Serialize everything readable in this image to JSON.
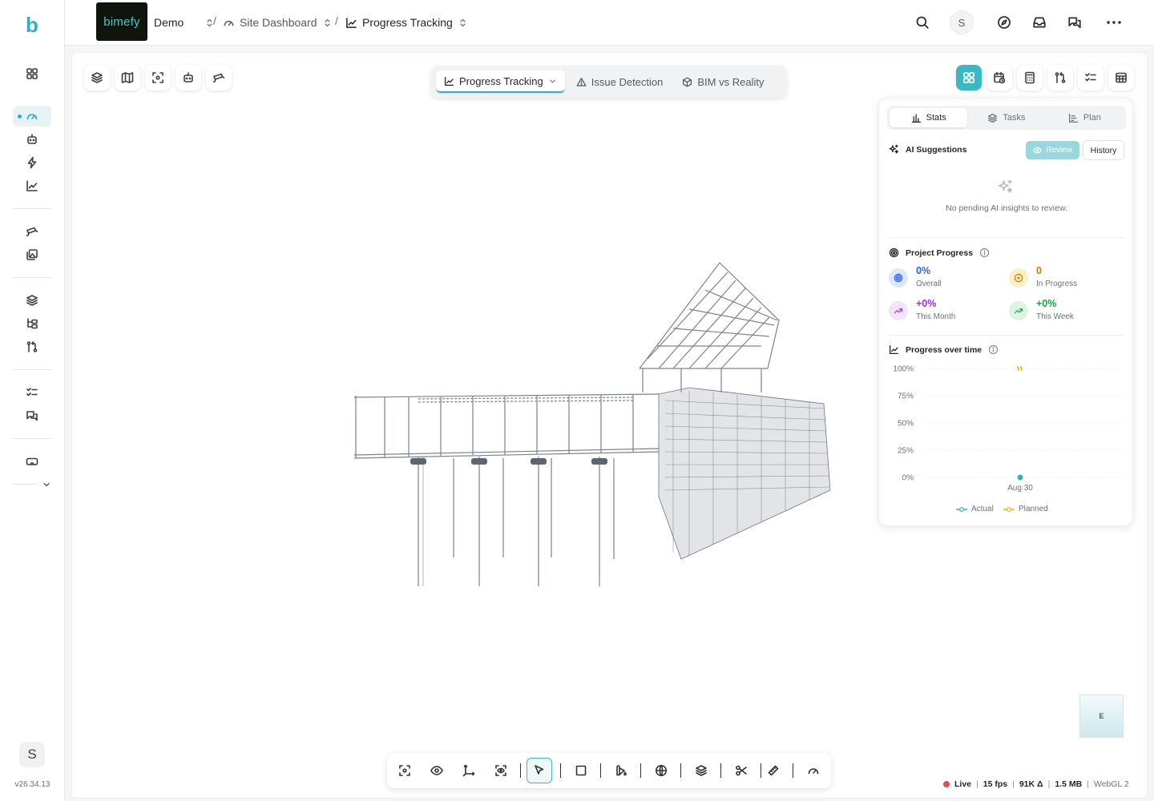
{
  "app": {
    "logo_letter": "b",
    "version": "v26.34.13",
    "user_initial": "S"
  },
  "brand": {
    "name": "bimefy"
  },
  "breadcrumb": {
    "project": "Demo",
    "sep1": "/",
    "section": "Site Dashboard",
    "sep2": "/",
    "page": "Progress Tracking"
  },
  "topbar": {
    "user_initial": "S"
  },
  "modes": [
    {
      "label": "Progress Tracking",
      "active": true
    },
    {
      "label": "Issue Detection",
      "active": false
    },
    {
      "label": "BIM vs Reality",
      "active": false
    }
  ],
  "panel": {
    "tabs": [
      "Stats",
      "Tasks",
      "Plan"
    ],
    "ai": {
      "title": "AI Suggestions",
      "review_label": "Review",
      "history_label": "History",
      "empty_text": "No pending AI insights to review."
    },
    "progress": {
      "title": "Project Progress",
      "stats": [
        {
          "value": "0%",
          "label": "Overall",
          "color": "#2563eb"
        },
        {
          "value": "0",
          "label": "In Progress",
          "color": "#d97706"
        },
        {
          "value": "+0%",
          "label": "This Month",
          "color": "#9333ea"
        },
        {
          "value": "+0%",
          "label": "This Week",
          "color": "#16a34a"
        }
      ]
    },
    "chart_title": "Progress over time",
    "legend": {
      "actual": "Actual",
      "planned": "Planned"
    }
  },
  "chart_data": {
    "type": "line",
    "title": "Progress over time",
    "x": [
      "Aug 30"
    ],
    "series": [
      {
        "name": "Actual",
        "values": [
          0
        ],
        "color": "#2fb1c0"
      },
      {
        "name": "Planned",
        "values": [
          100
        ],
        "color": "#eab308"
      }
    ],
    "y_ticks": [
      "100%",
      "75%",
      "50%",
      "25%",
      "0%"
    ],
    "ylim": [
      0,
      100
    ],
    "grid": true,
    "legend": "bottom"
  },
  "viewcube": {
    "face": "E"
  },
  "status": {
    "live": "Live",
    "fps": "15 fps",
    "tris": "91K Δ",
    "memory": "1.5 MB",
    "renderer": "WebGL 2"
  }
}
